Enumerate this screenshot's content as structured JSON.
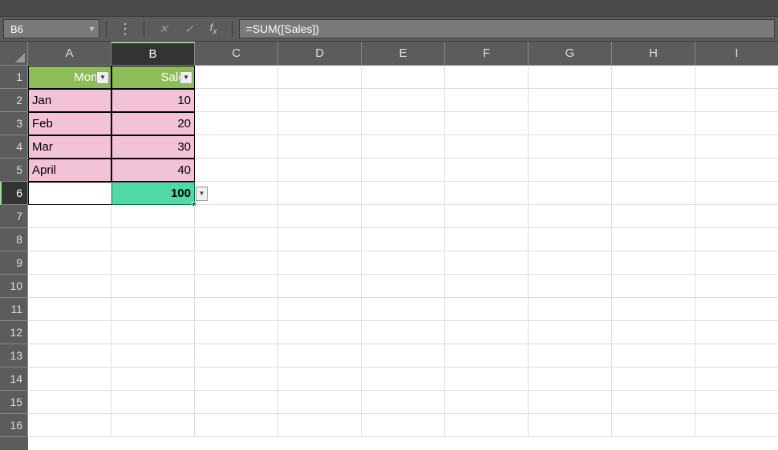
{
  "cell_ref": "B6",
  "formula": "=SUM([Sales])",
  "columns": [
    "A",
    "B",
    "C",
    "D",
    "E",
    "F",
    "G",
    "H",
    "I"
  ],
  "active_col": "B",
  "rows": [
    "1",
    "2",
    "3",
    "4",
    "5",
    "6",
    "7",
    "8",
    "9",
    "10",
    "11",
    "12",
    "13",
    "14",
    "15",
    "16"
  ],
  "active_row": "6",
  "table": {
    "headers": [
      "Month",
      "Sales"
    ],
    "data": [
      {
        "month": "Jan",
        "sales": "10"
      },
      {
        "month": "Feb",
        "sales": "20"
      },
      {
        "month": "Mar",
        "sales": "30"
      },
      {
        "month": "April",
        "sales": "40"
      }
    ],
    "total": "100"
  },
  "chart_data": {
    "type": "table",
    "title": "",
    "columns": [
      "Month",
      "Sales"
    ],
    "rows": [
      [
        "Jan",
        10
      ],
      [
        "Feb",
        20
      ],
      [
        "Mar",
        30
      ],
      [
        "April",
        40
      ]
    ],
    "totals": {
      "Sales": 100
    }
  }
}
